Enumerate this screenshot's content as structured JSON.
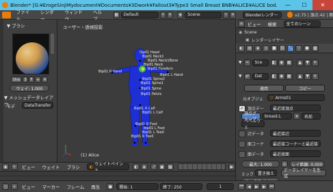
{
  "window": {
    "title": "Blender* [G:¥ErogeSinjiMydocument¥Documents¥3Dwork¥Fallout3¥Type3 Small Breast BNB¥ALICE¥ALICE bod...",
    "minimize": "—",
    "maximize": "☐",
    "close": "✕"
  },
  "menubar": {
    "items": [
      "ファイル",
      "レンダー",
      "ウィンドウ",
      "ヘルプ"
    ],
    "layout_value": "Default",
    "scene_value": "Scene",
    "engine_value": "Blenderレンダー",
    "version": "v2.75 | 頂点:42 | 面"
  },
  "left_panel": {
    "brush_header": "▼ ブラシ",
    "brush_name_short": "Dra",
    "brush_count": "3",
    "brush_f": "F",
    "weight_slider": "ウェイ: 1.000",
    "mesh_data_header": "▼ メッシュデータレイアウ",
    "mode_label": "モデ",
    "mode_value": "DataTransfer"
  },
  "viewport": {
    "view_label": "ユーザー・透視投影",
    "object_label": "(1) Alice",
    "bone_labels": [
      "Bip01 Head",
      "Bip01 Neck1",
      "Bip01 Neck1Bone",
      "Bip01 Neck",
      "Bip01 ForeArm",
      "Bip01 L Hand",
      "Bip01 R Hand",
      "Bip01 Spine2",
      "Bip01 Spine1",
      "Bip01 Spine",
      "Bip01 Pelvis",
      "Bip01 R Calf",
      "Bip01 L Calf",
      "Bip01 R Foot",
      "Bip01 L Foot",
      "Bip01 L Toe0",
      "Bip01 R Toe0"
    ]
  },
  "outliner": {
    "view_menu": "ビュー",
    "search_menu": "検索",
    "filter_value": "全てのシーン",
    "scene_item": "Scene",
    "layer_item": "レンダーレイヤー"
  },
  "properties": {
    "object_name": "Sce",
    "data_name": "Dat",
    "apply_button": "適用",
    "copy_button": "コピー",
    "source_label": "元オブジェ",
    "source_value": "Arms01",
    "vertex_data_label": "頂点デー",
    "vertex_mapping_value": "最近接頂点",
    "vgroup_label": "頂点グループ",
    "vgroup_value": "breast.L",
    "name_mode": "名前",
    "bevel_label": "ベベルウェ",
    "edge_data_label": "辺データ",
    "edge_mapping_value": "最近接辺",
    "corner_data_label": "面コーナ",
    "corner_mapping_value": "最近接コーナーと最近接",
    "face_data_label": "面データ",
    "face_mapping_value": "最近接面",
    "max_distance": "最大: 1.000",
    "ray_distance": "レイ距離: 0.000",
    "mix_label": "ミック",
    "mix_mode": "置き換え",
    "generate_button": "データレイヤーを生成",
    "mix_factor": "ミックス: 1.000"
  },
  "viewport_header": {
    "view_menu": "ビュー",
    "weight_menu": "ウェイト",
    "brush_menu": "ブラシ",
    "mode_value": "ウェイトペイント"
  },
  "statusbar": {
    "view_menu": "ビュー",
    "marker_menu": "マーカー",
    "frame_menu": "フレーム",
    "playback_menu": "再生",
    "start_field": "開始:      1",
    "end_field": "終了:    250",
    "current_frame": "1"
  },
  "colors": {
    "titlebar": "#5cc4e8",
    "mesh": "#1e2fd6",
    "selection": "#e87d0d",
    "highlight": "#5680c2"
  }
}
